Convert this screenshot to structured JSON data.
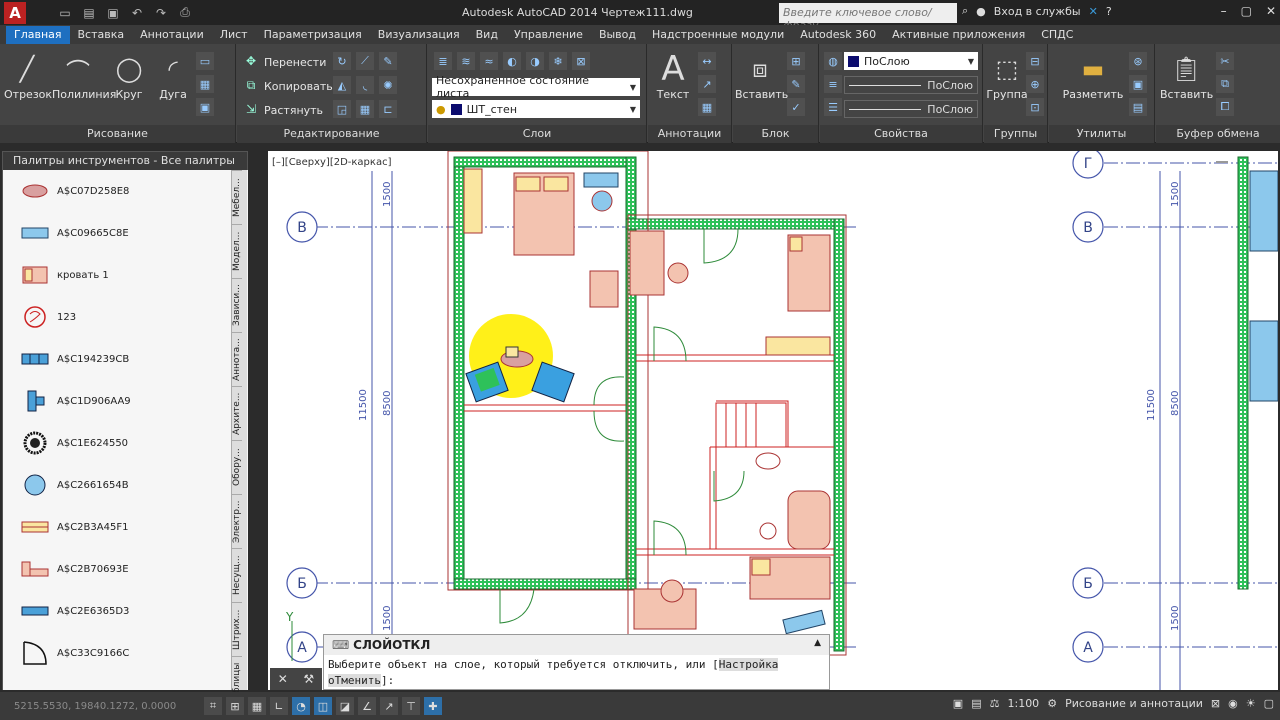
{
  "app": {
    "title": "Autodesk AutoCAD 2014   Чертеж111.dwg",
    "search_placeholder": "Введите ключевое слово/фразу",
    "signin": "Вход в службы",
    "logo_letter": "A"
  },
  "tabs": [
    "Главная",
    "Вставка",
    "Аннотации",
    "Лист",
    "Параметризация",
    "Визуализация",
    "Вид",
    "Управление",
    "Вывод",
    "Надстроенные модули",
    "Autodesk 360",
    "Активные приложения",
    "СПДС"
  ],
  "ribbon": {
    "draw": {
      "title": "Рисование",
      "line": "Отрезок",
      "polyline": "Полилиния",
      "circle": "Круг",
      "arc": "Дуга"
    },
    "modify": {
      "title": "Редактирование",
      "move": "Перенести",
      "copy": "Копировать",
      "stretch": "Растянуть"
    },
    "layers": {
      "title": "Слои",
      "state": "Несохраненное состояние листа",
      "current": "ШТ_стен"
    },
    "annotation": {
      "title": "Аннотации",
      "text": "Текст"
    },
    "block": {
      "title": "Блок",
      "insert": "Вставить"
    },
    "properties": {
      "title": "Свойства",
      "color": "ПоСлою",
      "linetype": "ПоСлою",
      "lineweight": "ПоСлою"
    },
    "groups": {
      "title": "Группы",
      "group": "Группа"
    },
    "utilities": {
      "title": "Утилиты",
      "measure": "Разметить"
    },
    "clipboard": {
      "title": "Буфер обмена",
      "paste": "Вставить"
    }
  },
  "palette": {
    "title": "Палитры инструментов - Все палитры",
    "items": [
      "A$C07D258E8",
      "A$C09665C8E",
      "кровать 1",
      "123",
      "A$C194239CB",
      "A$C1D906AA9",
      "A$C1E624550",
      "A$C2661654B",
      "A$C2B3A45F1",
      "A$C2B70693E",
      "A$C2E6365D3",
      "A$C33C9166C"
    ],
    "tabs": [
      "Мебел...",
      "Модел...",
      "Зависи...",
      "Аннота...",
      "Архите...",
      "Обору...",
      "Электр...",
      "Несущ...",
      "Штрих...",
      "Таблицы"
    ]
  },
  "viewport": {
    "label": "[–][Сверху][2D-каркас]",
    "axes": {
      "v": "В",
      "g": "Г",
      "b": "Б",
      "a": "А"
    },
    "dims": {
      "d1500": "1500",
      "d8500": "8500",
      "d11500": "11500"
    },
    "ucs_y": "Y"
  },
  "command": {
    "name": "СЛОЙОТКЛ",
    "prompt": "Выберите объект на слое, который требуется отключить, или [",
    "opt1": "Настройка",
    "opt2": "оТменить",
    "end": "]:"
  },
  "status": {
    "coords": "5215.5530, 19840.1272, 0.0000",
    "scale": "1:100",
    "workspace": "Рисование и аннотации"
  }
}
